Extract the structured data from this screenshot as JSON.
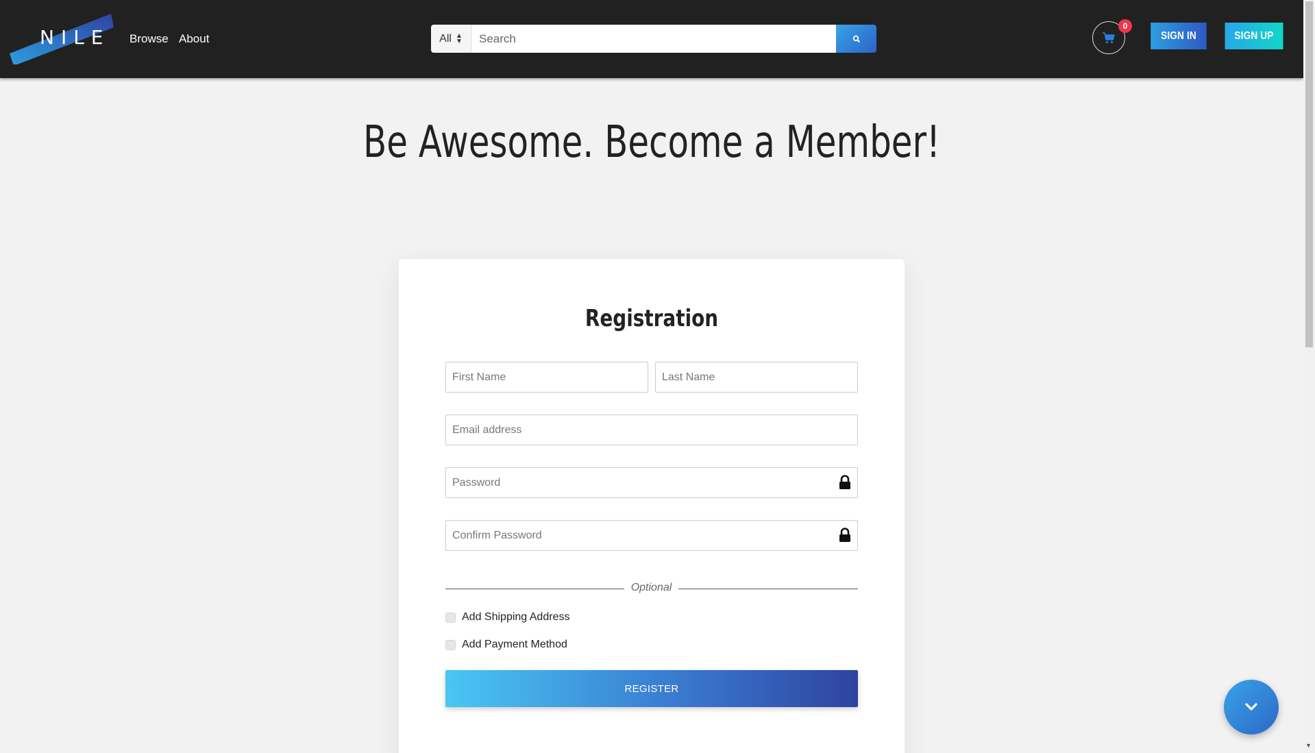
{
  "brand": {
    "logo_text": "NILE",
    "gradient_start": "#2d9ee0",
    "gradient_end": "#2e43a1"
  },
  "nav": {
    "browse": "Browse",
    "about": "About"
  },
  "search": {
    "category": "All",
    "placeholder": "Search",
    "button_icon": "search-icon"
  },
  "cart": {
    "icon": "cart-icon",
    "count": "0"
  },
  "auth": {
    "sign_in": "SIGN IN",
    "sign_up": "SIGN UP"
  },
  "hero": {
    "title": "Be Awesome. Become a Member!"
  },
  "form": {
    "title": "Registration",
    "first_name_placeholder": "First Name",
    "last_name_placeholder": "Last Name",
    "email_placeholder": "Email address",
    "password_placeholder": "Password",
    "confirm_password_placeholder": "Confirm Password",
    "optional_label": "Optional",
    "shipping_label": "Add Shipping Address",
    "payment_label": "Add Payment Method",
    "submit_label": "REGISTER"
  },
  "fab": {
    "icon": "chevron-down-icon"
  }
}
